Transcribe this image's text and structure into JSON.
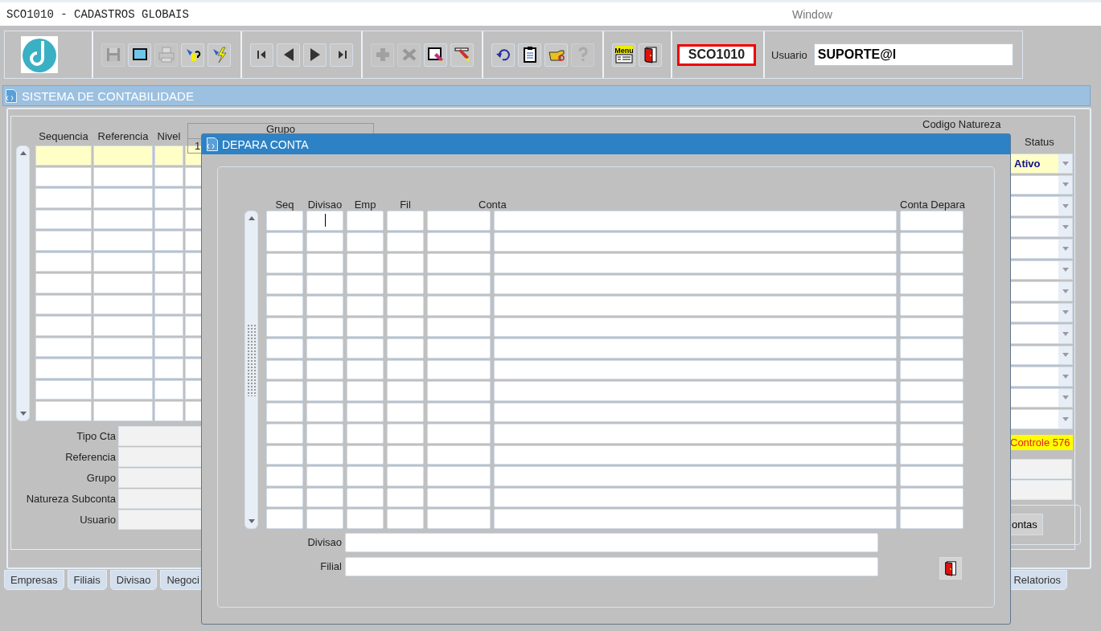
{
  "window": {
    "title": "SCO1010 - CADASTROS GLOBAIS",
    "menu": "Window"
  },
  "toolbar": {
    "groups": [
      [
        {
          "kind": "save",
          "disabled": true
        },
        {
          "kind": "screen",
          "disabled": false
        },
        {
          "kind": "print",
          "disabled": true
        },
        {
          "kind": "query",
          "disabled": false
        },
        {
          "kind": "execute",
          "disabled": false
        }
      ],
      [
        {
          "kind": "first",
          "disabled": false
        },
        {
          "kind": "prev",
          "disabled": false
        },
        {
          "kind": "next",
          "disabled": false
        },
        {
          "kind": "last",
          "disabled": false
        }
      ],
      [
        {
          "kind": "insert",
          "disabled": true
        },
        {
          "kind": "delete",
          "disabled": true
        },
        {
          "kind": "edit",
          "disabled": false
        },
        {
          "kind": "erase",
          "disabled": false
        }
      ],
      [
        {
          "kind": "undo",
          "disabled": false
        },
        {
          "kind": "clipboard",
          "disabled": false
        },
        {
          "kind": "hand",
          "disabled": false
        },
        {
          "kind": "help",
          "disabled": true
        }
      ],
      [
        {
          "kind": "menu",
          "label": "Menu",
          "disabled": false
        },
        {
          "kind": "exit",
          "disabled": false
        }
      ]
    ],
    "form_code": "SCO1010",
    "user_label": "Usuario",
    "user_value": "SUPORTE@l"
  },
  "main": {
    "title": "SISTEMA DE CONTABILIDADE",
    "columns": [
      "Sequencia",
      "Referencia",
      "Nivel"
    ],
    "group_header": "Grupo",
    "group_subheader": "1",
    "right_header": "Codigo Natureza",
    "status_header": "Status",
    "rows": [
      {
        "selected": true,
        "status": "Ativo"
      },
      {
        "selected": false
      },
      {
        "selected": false
      },
      {
        "selected": false
      },
      {
        "selected": false
      },
      {
        "selected": false
      },
      {
        "selected": false
      },
      {
        "selected": false
      },
      {
        "selected": false
      },
      {
        "selected": false
      },
      {
        "selected": false
      },
      {
        "selected": false
      },
      {
        "selected": false
      }
    ],
    "details": [
      "Tipo Cta",
      "Referencia",
      "Grupo",
      "Natureza Subconta",
      "Usuario"
    ],
    "controle": "Controle 576",
    "contas_button": "ontas",
    "tabs": [
      {
        "label": "Empresas",
        "selected": false
      },
      {
        "label": "Filiais",
        "selected": false
      },
      {
        "label": "Divisao",
        "selected": false
      },
      {
        "label": "Negoci",
        "selected": false
      },
      {
        "label": "Relatorios",
        "selected": false
      }
    ]
  },
  "dialog": {
    "title": "DEPARA CONTA",
    "columns": [
      {
        "label": "Seq",
        "focused": false
      },
      {
        "label": "Divisao",
        "focused": true
      },
      {
        "label": "Emp",
        "focused": false
      },
      {
        "label": "Fil",
        "focused": false
      },
      {
        "label": "Conta",
        "focused": false
      },
      {
        "label": "Conta Depara",
        "focused": false
      }
    ],
    "rows": [
      {
        "focused": true
      },
      {
        "focused": false
      },
      {
        "focused": false
      },
      {
        "focused": false
      },
      {
        "focused": false
      },
      {
        "focused": false
      },
      {
        "focused": false
      },
      {
        "focused": false
      },
      {
        "focused": false
      },
      {
        "focused": false
      },
      {
        "focused": false
      },
      {
        "focused": false
      },
      {
        "focused": false
      },
      {
        "focused": false
      },
      {
        "focused": false
      }
    ],
    "fields": [
      "Divisao",
      "Filial"
    ]
  }
}
